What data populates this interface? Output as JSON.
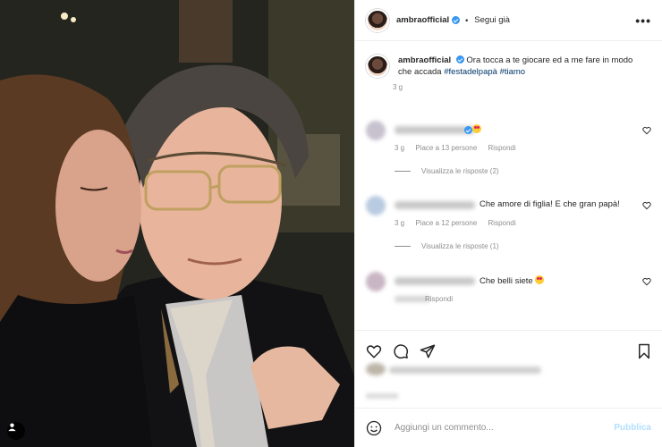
{
  "header": {
    "username": "ambraofficial",
    "follow_status": "Segui già",
    "more_icon": "more-horizontal-icon"
  },
  "caption": {
    "username": "ambraofficial",
    "text": "Ora tocca a te giocare ed a me fare in modo che accada",
    "hashtags": [
      "#festadelpapà",
      "#tiamo"
    ],
    "age": "3 g"
  },
  "comments": [
    {
      "text": "",
      "has_emoji": true,
      "age": "3 g",
      "likes": "Piace a 13 persone",
      "reply": "Rispondi",
      "view_replies": "Visualizza le risposte (2)"
    },
    {
      "text": "Che amore di figlia! E che gran papà!",
      "age": "3 g",
      "likes": "Piace a 12 persone",
      "reply": "Rispondi",
      "view_replies": "Visualizza le risposte (1)"
    },
    {
      "text": "Che belli siete",
      "has_emoji": true,
      "reply": "Rispondi"
    }
  ],
  "actions": {
    "icons": [
      "heart-icon",
      "comment-icon",
      "share-icon",
      "bookmark-icon"
    ]
  },
  "add_comment": {
    "placeholder": "Aggiungi un commento...",
    "publish": "Pubblica"
  },
  "colors": {
    "verified": "#3897f0",
    "hashtag": "#00376b",
    "publish_disabled": "#b2dffc",
    "muted": "#8e8e8e"
  }
}
